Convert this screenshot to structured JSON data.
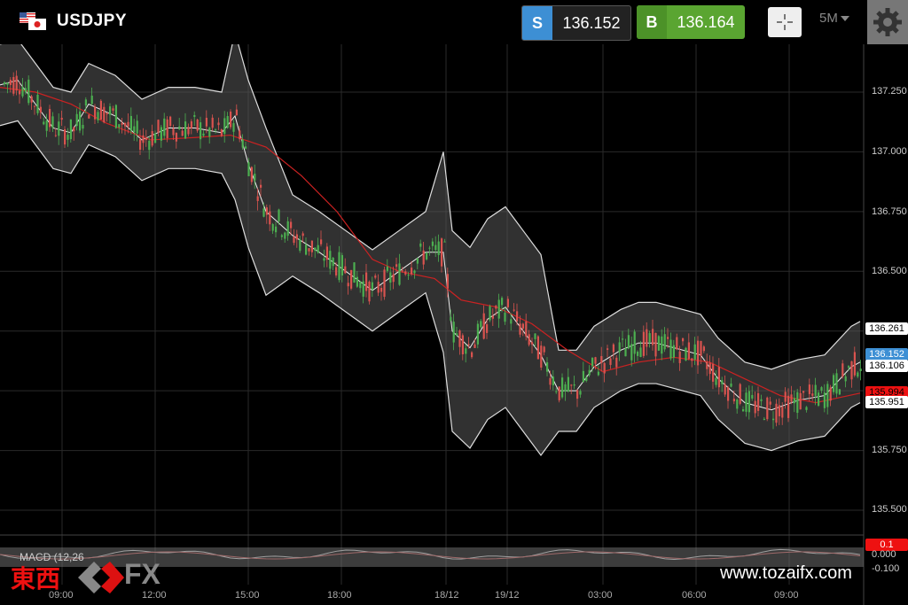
{
  "header": {
    "symbol": "USDJPY",
    "sell": {
      "tag": "S",
      "price": "136.152"
    },
    "buy": {
      "tag": "B",
      "price": "136.164"
    },
    "timeframe": "5M"
  },
  "price_axis": {
    "ticks": [
      "137.250",
      "137.000",
      "136.750",
      "136.500",
      "135.750",
      "135.500"
    ],
    "tags": {
      "upper_band": "136.261",
      "current": "136.152",
      "middle_band": "136.106",
      "ma": "135.994",
      "lower_band": "135.951"
    },
    "macd_ticks": [
      "0.1",
      "0.000",
      "-0.100"
    ]
  },
  "time_axis": [
    "09:00",
    "12:00",
    "15:00",
    "18:00",
    "18/12",
    "19/12",
    "03:00",
    "06:00",
    "09:00"
  ],
  "macd": {
    "label": "MACD (12,26"
  },
  "watermark": {
    "kanji": "東西",
    "fx": "FX",
    "website": "www.tozaifx.com"
  },
  "colors": {
    "sell": "#3d8fd4",
    "buy": "#5aa531",
    "ma": "#cc2222",
    "band": "#ffffff",
    "bull": "#4caf50",
    "bear": "#d9534f"
  },
  "chart_data": {
    "type": "candlestick",
    "ylim": [
      135.4,
      137.4
    ],
    "grid": true
  }
}
